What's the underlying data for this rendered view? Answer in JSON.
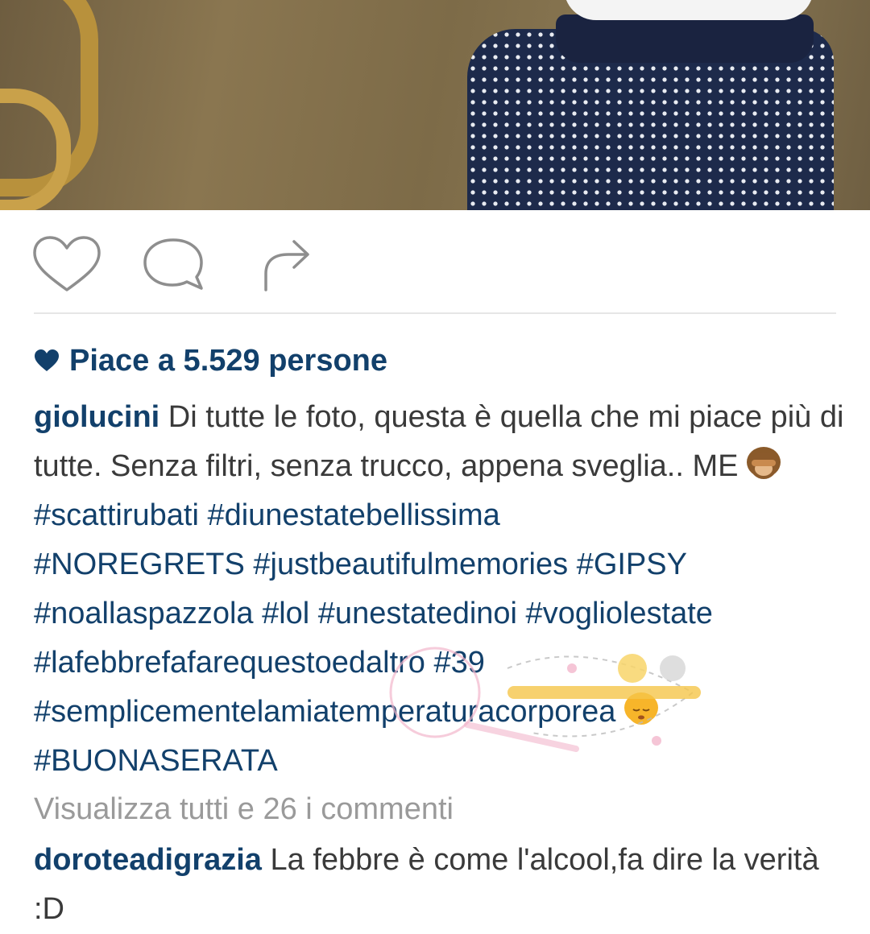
{
  "post": {
    "likes_text": "Piace a 5.529 persone",
    "caption": {
      "username": "giolucini",
      "text": "Di tutte le foto, questa è quella che mi piace più di tutte. Senza filtri, senza trucco, appena sveglia.. ME",
      "hashtags_line1": "#scattirubati #diunestatebellissima",
      "hashtags_line2": "#NOREGRETS #justbeautifulmemories #GIPSY",
      "hashtags_line3": "#noallaspazzola #lol #unestatedinoi #vogliolestate",
      "hashtags_line4": "#lafebbrefafarequestoedaltro #39",
      "hashtags_line5": "#semplicementelamiatemperaturacorporea",
      "hashtags_line6": "#BUONASERATA",
      "emoji_1": "see-no-evil-monkey-icon",
      "emoji_2": "sleepy-face-icon"
    },
    "view_all_comments": "Visualizza tutti e 26 i commenti",
    "comment": {
      "username": "doroteadigrazia",
      "text": "La febbre è come l'alcool,fa dire la verità :D"
    }
  },
  "actions": {
    "like_icon": "heart-outline-icon",
    "comment_icon": "comment-bubble-icon",
    "share_icon": "share-arrow-icon"
  },
  "colors": {
    "link": "#12406b",
    "text": "#3a3a3a",
    "muted": "#9a9a9a",
    "divider": "#e6e6e6"
  }
}
